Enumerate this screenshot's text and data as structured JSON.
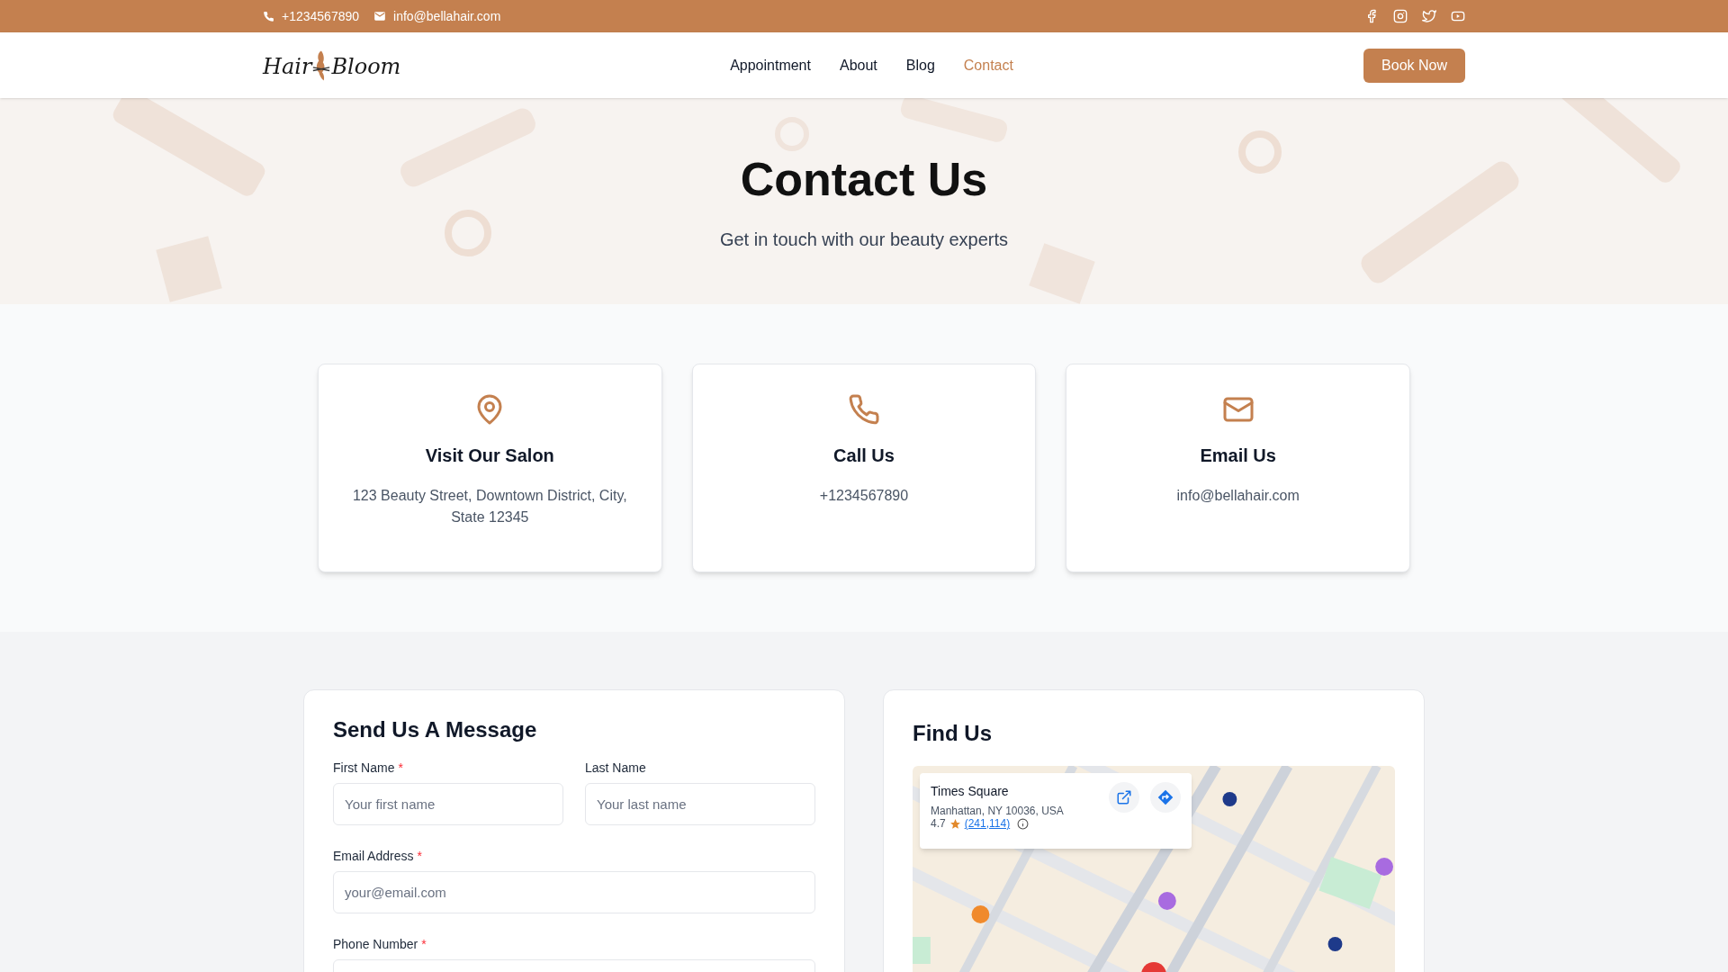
{
  "topbar": {
    "phone": "+1234567890",
    "email": "info@bellahair.com",
    "social": [
      {
        "kind": "facebook"
      },
      {
        "kind": "instagram"
      },
      {
        "kind": "twitter"
      },
      {
        "kind": "youtube"
      }
    ]
  },
  "nav": {
    "logo": {
      "left": "Hair",
      "right": "Bloom"
    },
    "links": [
      {
        "label": "Appointment",
        "selected": false
      },
      {
        "label": "About",
        "selected": false
      },
      {
        "label": "Blog",
        "selected": false
      },
      {
        "label": "Contact",
        "selected": true
      }
    ],
    "button": "Book Now"
  },
  "hero": {
    "title": "Contact Us",
    "subtitle": "Get in touch with our beauty experts"
  },
  "info_cards": [
    {
      "kind": "location",
      "title": "Visit Our Salon",
      "text": "123 Beauty Street, Downtown District, City, State 12345"
    },
    {
      "kind": "phone",
      "title": "Call Us",
      "text": "+1234567890"
    },
    {
      "kind": "email",
      "title": "Email Us",
      "text": "info@bellahair.com"
    }
  ],
  "form": {
    "title": "Send Us A Message",
    "required_mark": "*",
    "rows": [
      [
        {
          "label": "First Name",
          "required": true,
          "placeholder": "Your first name"
        },
        {
          "label": "Last Name",
          "required": false,
          "placeholder": "Your last name"
        }
      ],
      [
        {
          "label": "Email Address",
          "required": true,
          "placeholder": "your@email.com"
        }
      ],
      [
        {
          "label": "Phone Number",
          "required": true
        }
      ]
    ]
  },
  "map": {
    "title": "Find Us",
    "place": {
      "name": "Times Square",
      "address": "Manhattan, NY 10036, USA",
      "rating": "4.7",
      "reviews": "(241,114)"
    }
  }
}
